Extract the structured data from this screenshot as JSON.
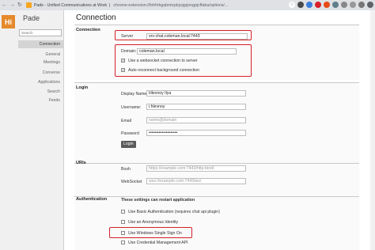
{
  "browser": {
    "tab_title": "Pade - Unified Communications at Work",
    "url": "chrome-extension://fohfnhgabmicpkjcpjpjongpjcffaba/options/..."
  },
  "sidebar": {
    "logo": "Hi",
    "app_name": "Pade",
    "search_placeholder": "Search",
    "items": [
      {
        "label": "Connection"
      },
      {
        "label": "General"
      },
      {
        "label": "Meetings"
      },
      {
        "label": "Converse"
      },
      {
        "label": "Applications"
      },
      {
        "label": "Search"
      },
      {
        "label": "Feeds"
      }
    ]
  },
  "page_title": "Connection",
  "connection": {
    "title": "Connection",
    "server_label": "Server",
    "server_value": "srv-chat.coleman.local:7443",
    "domain_label": "Domain:",
    "domain_value": "coleman.local",
    "websocket_label": "Use a websocket connection to server",
    "websocket_checked": true,
    "reconnect_label": "Auto reconnect background connection",
    "reconnect_checked": true
  },
  "login": {
    "title": "Login",
    "display_name_label": "Display Name:",
    "display_name_value": "Hlevnoy Ilya",
    "username_label": "Username:",
    "username_value": "i.hlevnoy",
    "email_label": "Email",
    "email_placeholder": "name@domain",
    "password_label": "Password",
    "password_value": "••••••••••••••••••••",
    "login_button": "Login"
  },
  "uris": {
    "title": "URIs",
    "bosh_label": "Bosh",
    "bosh_placeholder": "https://example.com:7443/http-bind/",
    "websocket_label": "WebSocket",
    "websocket_placeholder": "wss://example.com:7443/ws/"
  },
  "authentication": {
    "title": "Authentication",
    "note": "These settings can restart application",
    "options": [
      {
        "label": "Use Basic Authentication (requires chat api plugin)",
        "checked": false
      },
      {
        "label": "Use an Anonymous Identity",
        "checked": false
      },
      {
        "label": "Use Windows Single Sign On",
        "checked": false
      },
      {
        "label": "Use Credential Management API",
        "checked": false
      }
    ]
  },
  "colors": {
    "highlight": "#d6202a",
    "logo": "#e58a2c"
  }
}
